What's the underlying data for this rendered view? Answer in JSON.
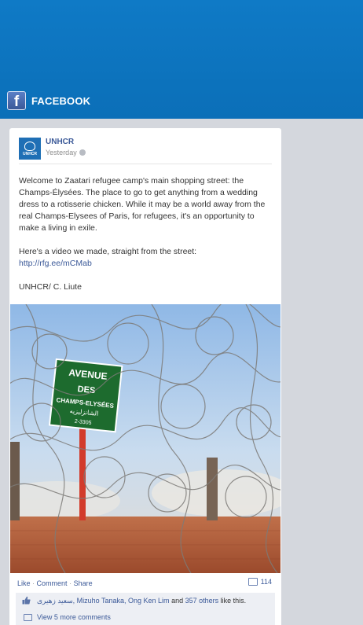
{
  "app": {
    "title": "FACEBOOK",
    "logo_glyph": "f",
    "brand_color": "#0b6fb8"
  },
  "post": {
    "author": "UNHCR",
    "avatar_label": "UNHCR",
    "timestamp": "Yesterday",
    "paragraphs": [
      "Welcome to Zaatari refugee camp's main shopping street: the Champs-Élysées. The place to go to get anything from a wedding dress to a rotisserie chicken. While it may be a world away from the real Champs-Elysees of Paris, for refugees, it's an opportunity to make a living in exile.",
      "Here's a video we made, straight from the street:",
      "UNHCR/ C. Liute"
    ],
    "link": "http://rfg.ee/mCMab",
    "photo": {
      "sign_line1": "AVENUE",
      "sign_line2": "DES",
      "sign_line3": "CHAMPS-ELYSÉES",
      "sign_arabic": "الشانزليزيه",
      "sign_number": "2-3305"
    }
  },
  "actions": {
    "like": "Like",
    "comment": "Comment",
    "share": "Share",
    "separator": "·",
    "comment_count": "114"
  },
  "likes": {
    "names": "سعيد زهيرى, Mizuho Tanaka, Ong Ken Lim",
    "and": " and ",
    "others": "357 others",
    "suffix": " like this."
  },
  "comments": {
    "view_more": "View 5 more comments"
  }
}
